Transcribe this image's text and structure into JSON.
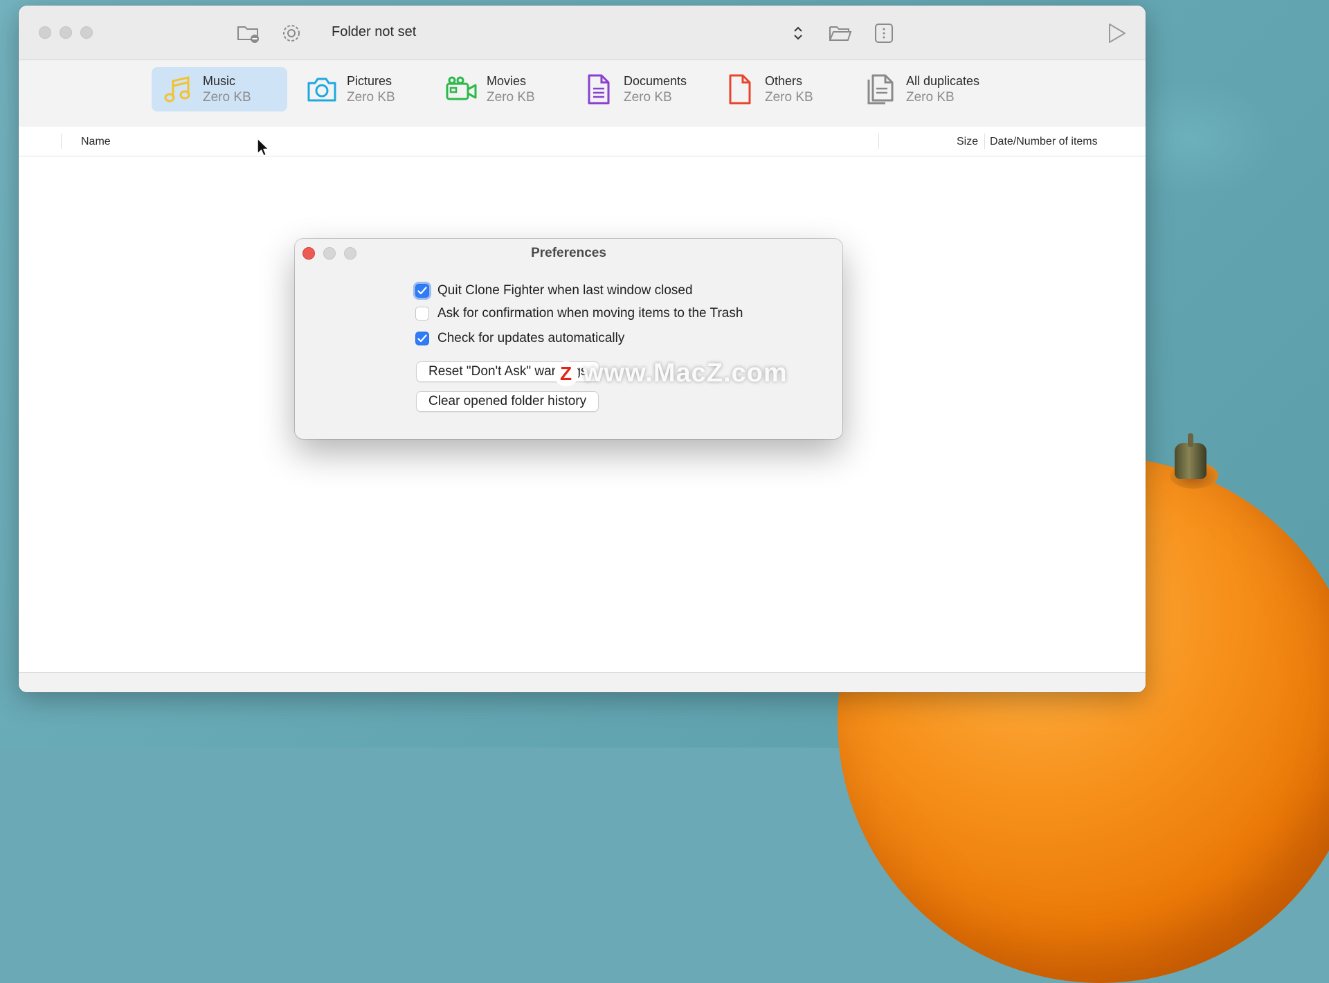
{
  "window": {
    "folder_title": "Folder not set"
  },
  "categories": [
    {
      "label": "Music",
      "size": "Zero KB",
      "icon": "music-note-icon",
      "color": "#f2c230",
      "active": true
    },
    {
      "label": "Pictures",
      "size": "Zero KB",
      "icon": "camera-icon",
      "color": "#1fa8e0"
    },
    {
      "label": "Movies",
      "size": "Zero KB",
      "icon": "video-camera-icon",
      "color": "#2db84a"
    },
    {
      "label": "Documents",
      "size": "Zero KB",
      "icon": "document-icon",
      "color": "#8a3fd1"
    },
    {
      "label": "Others",
      "size": "Zero KB",
      "icon": "file-icon",
      "color": "#e8442e"
    },
    {
      "label": "All duplicates",
      "size": "Zero KB",
      "icon": "duplicates-icon",
      "color": "#8a8a8a"
    }
  ],
  "table_header": {
    "name": "Name",
    "size": "Size",
    "date": "Date/Number of items"
  },
  "preferences": {
    "title": "Preferences",
    "options": [
      {
        "label": "Quit Clone Fighter when last window closed",
        "checked": true
      },
      {
        "label": "Ask for confirmation when moving items to the Trash",
        "checked": false
      },
      {
        "label": "Check for updates automatically",
        "checked": true
      }
    ],
    "reset_button": "Reset \"Don't Ask\" warnings",
    "clear_button": "Clear opened folder history"
  },
  "watermark": {
    "logo_letter": "Z",
    "text": "www.MacZ.com"
  },
  "colors": {
    "accent": "#2f7cf6",
    "close_red": "#ed5b52",
    "selected_category_bg": "#cfe3f7"
  }
}
